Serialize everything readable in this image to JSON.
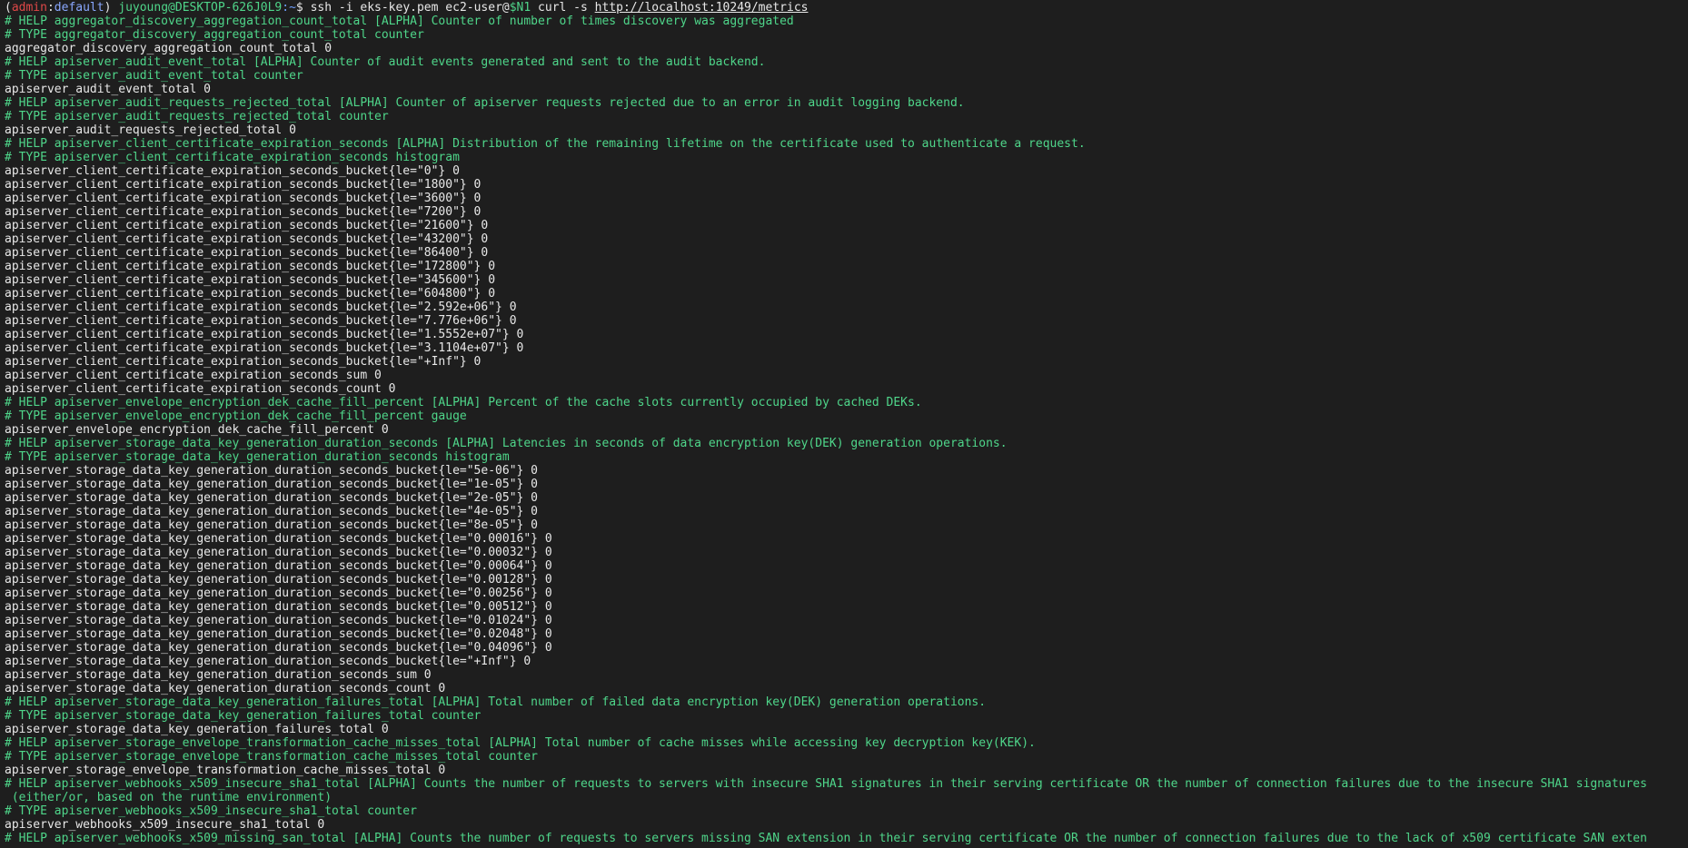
{
  "prompt": {
    "open_paren": "(",
    "env": "admin",
    "sep": ":",
    "context": "default",
    "close_paren": ")",
    "user_host": " juyoung@DESKTOP-626J0L9",
    "path": ":~",
    "dollar": "$ ",
    "command": "ssh -i eks-key.pem ec2-user@",
    "var": "$N1",
    "command2": " curl -s ",
    "url": "http://localhost:10249/metrics"
  },
  "lines": [
    {
      "kind": "help",
      "text": "# HELP aggregator_discovery_aggregation_count_total [ALPHA] Counter of number of times discovery was aggregated"
    },
    {
      "kind": "type",
      "text": "# TYPE aggregator_discovery_aggregation_count_total counter"
    },
    {
      "kind": "metric",
      "text": "aggregator_discovery_aggregation_count_total 0"
    },
    {
      "kind": "help",
      "text": "# HELP apiserver_audit_event_total [ALPHA] Counter of audit events generated and sent to the audit backend."
    },
    {
      "kind": "type",
      "text": "# TYPE apiserver_audit_event_total counter"
    },
    {
      "kind": "metric",
      "text": "apiserver_audit_event_total 0"
    },
    {
      "kind": "help",
      "text": "# HELP apiserver_audit_requests_rejected_total [ALPHA] Counter of apiserver requests rejected due to an error in audit logging backend."
    },
    {
      "kind": "type",
      "text": "# TYPE apiserver_audit_requests_rejected_total counter"
    },
    {
      "kind": "metric",
      "text": "apiserver_audit_requests_rejected_total 0"
    },
    {
      "kind": "help",
      "text": "# HELP apiserver_client_certificate_expiration_seconds [ALPHA] Distribution of the remaining lifetime on the certificate used to authenticate a request."
    },
    {
      "kind": "type",
      "text": "# TYPE apiserver_client_certificate_expiration_seconds histogram"
    },
    {
      "kind": "metric",
      "text": "apiserver_client_certificate_expiration_seconds_bucket{le=\"0\"} 0"
    },
    {
      "kind": "metric",
      "text": "apiserver_client_certificate_expiration_seconds_bucket{le=\"1800\"} 0"
    },
    {
      "kind": "metric",
      "text": "apiserver_client_certificate_expiration_seconds_bucket{le=\"3600\"} 0"
    },
    {
      "kind": "metric",
      "text": "apiserver_client_certificate_expiration_seconds_bucket{le=\"7200\"} 0"
    },
    {
      "kind": "metric",
      "text": "apiserver_client_certificate_expiration_seconds_bucket{le=\"21600\"} 0"
    },
    {
      "kind": "metric",
      "text": "apiserver_client_certificate_expiration_seconds_bucket{le=\"43200\"} 0"
    },
    {
      "kind": "metric",
      "text": "apiserver_client_certificate_expiration_seconds_bucket{le=\"86400\"} 0"
    },
    {
      "kind": "metric",
      "text": "apiserver_client_certificate_expiration_seconds_bucket{le=\"172800\"} 0"
    },
    {
      "kind": "metric",
      "text": "apiserver_client_certificate_expiration_seconds_bucket{le=\"345600\"} 0"
    },
    {
      "kind": "metric",
      "text": "apiserver_client_certificate_expiration_seconds_bucket{le=\"604800\"} 0"
    },
    {
      "kind": "metric",
      "text": "apiserver_client_certificate_expiration_seconds_bucket{le=\"2.592e+06\"} 0"
    },
    {
      "kind": "metric",
      "text": "apiserver_client_certificate_expiration_seconds_bucket{le=\"7.776e+06\"} 0"
    },
    {
      "kind": "metric",
      "text": "apiserver_client_certificate_expiration_seconds_bucket{le=\"1.5552e+07\"} 0"
    },
    {
      "kind": "metric",
      "text": "apiserver_client_certificate_expiration_seconds_bucket{le=\"3.1104e+07\"} 0"
    },
    {
      "kind": "metric",
      "text": "apiserver_client_certificate_expiration_seconds_bucket{le=\"+Inf\"} 0"
    },
    {
      "kind": "metric",
      "text": "apiserver_client_certificate_expiration_seconds_sum 0"
    },
    {
      "kind": "metric",
      "text": "apiserver_client_certificate_expiration_seconds_count 0"
    },
    {
      "kind": "help",
      "text": "# HELP apiserver_envelope_encryption_dek_cache_fill_percent [ALPHA] Percent of the cache slots currently occupied by cached DEKs."
    },
    {
      "kind": "type",
      "text": "# TYPE apiserver_envelope_encryption_dek_cache_fill_percent gauge"
    },
    {
      "kind": "metric",
      "text": "apiserver_envelope_encryption_dek_cache_fill_percent 0"
    },
    {
      "kind": "help",
      "text": "# HELP apiserver_storage_data_key_generation_duration_seconds [ALPHA] Latencies in seconds of data encryption key(DEK) generation operations."
    },
    {
      "kind": "type",
      "text": "# TYPE apiserver_storage_data_key_generation_duration_seconds histogram"
    },
    {
      "kind": "metric",
      "text": "apiserver_storage_data_key_generation_duration_seconds_bucket{le=\"5e-06\"} 0"
    },
    {
      "kind": "metric",
      "text": "apiserver_storage_data_key_generation_duration_seconds_bucket{le=\"1e-05\"} 0"
    },
    {
      "kind": "metric",
      "text": "apiserver_storage_data_key_generation_duration_seconds_bucket{le=\"2e-05\"} 0"
    },
    {
      "kind": "metric",
      "text": "apiserver_storage_data_key_generation_duration_seconds_bucket{le=\"4e-05\"} 0"
    },
    {
      "kind": "metric",
      "text": "apiserver_storage_data_key_generation_duration_seconds_bucket{le=\"8e-05\"} 0"
    },
    {
      "kind": "metric",
      "text": "apiserver_storage_data_key_generation_duration_seconds_bucket{le=\"0.00016\"} 0"
    },
    {
      "kind": "metric",
      "text": "apiserver_storage_data_key_generation_duration_seconds_bucket{le=\"0.00032\"} 0"
    },
    {
      "kind": "metric",
      "text": "apiserver_storage_data_key_generation_duration_seconds_bucket{le=\"0.00064\"} 0"
    },
    {
      "kind": "metric",
      "text": "apiserver_storage_data_key_generation_duration_seconds_bucket{le=\"0.00128\"} 0"
    },
    {
      "kind": "metric",
      "text": "apiserver_storage_data_key_generation_duration_seconds_bucket{le=\"0.00256\"} 0"
    },
    {
      "kind": "metric",
      "text": "apiserver_storage_data_key_generation_duration_seconds_bucket{le=\"0.00512\"} 0"
    },
    {
      "kind": "metric",
      "text": "apiserver_storage_data_key_generation_duration_seconds_bucket{le=\"0.01024\"} 0"
    },
    {
      "kind": "metric",
      "text": "apiserver_storage_data_key_generation_duration_seconds_bucket{le=\"0.02048\"} 0"
    },
    {
      "kind": "metric",
      "text": "apiserver_storage_data_key_generation_duration_seconds_bucket{le=\"0.04096\"} 0"
    },
    {
      "kind": "metric",
      "text": "apiserver_storage_data_key_generation_duration_seconds_bucket{le=\"+Inf\"} 0"
    },
    {
      "kind": "metric",
      "text": "apiserver_storage_data_key_generation_duration_seconds_sum 0"
    },
    {
      "kind": "metric",
      "text": "apiserver_storage_data_key_generation_duration_seconds_count 0"
    },
    {
      "kind": "help",
      "text": "# HELP apiserver_storage_data_key_generation_failures_total [ALPHA] Total number of failed data encryption key(DEK) generation operations."
    },
    {
      "kind": "type",
      "text": "# TYPE apiserver_storage_data_key_generation_failures_total counter"
    },
    {
      "kind": "metric",
      "text": "apiserver_storage_data_key_generation_failures_total 0"
    },
    {
      "kind": "help",
      "text": "# HELP apiserver_storage_envelope_transformation_cache_misses_total [ALPHA] Total number of cache misses while accessing key decryption key(KEK)."
    },
    {
      "kind": "type",
      "text": "# TYPE apiserver_storage_envelope_transformation_cache_misses_total counter"
    },
    {
      "kind": "metric",
      "text": "apiserver_storage_envelope_transformation_cache_misses_total 0"
    },
    {
      "kind": "help",
      "text": "# HELP apiserver_webhooks_x509_insecure_sha1_total [ALPHA] Counts the number of requests to servers with insecure SHA1 signatures in their serving certificate OR the number of connection failures due to the insecure SHA1 signatures"
    },
    {
      "kind": "help",
      "text": " (either/or, based on the runtime environment)"
    },
    {
      "kind": "type",
      "text": "# TYPE apiserver_webhooks_x509_insecure_sha1_total counter"
    },
    {
      "kind": "metric",
      "text": "apiserver_webhooks_x509_insecure_sha1_total 0"
    },
    {
      "kind": "help",
      "text": "# HELP apiserver_webhooks_x509_missing_san_total [ALPHA] Counts the number of requests to servers missing SAN extension in their serving certificate OR the number of connection failures due to the lack of x509 certificate SAN exten"
    }
  ]
}
